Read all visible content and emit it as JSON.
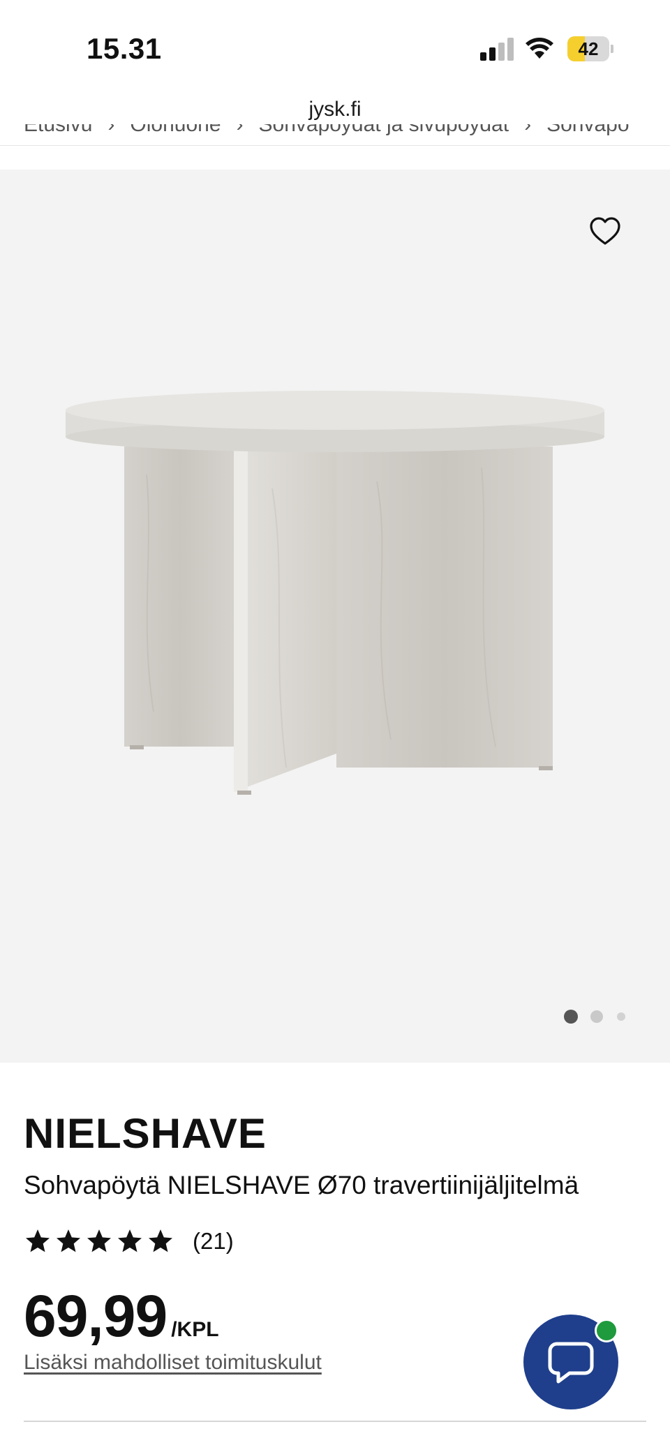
{
  "status_bar": {
    "time": "15.31",
    "battery_level": "42",
    "battery_fraction": 0.42,
    "signal_bars_active": 2,
    "icons": [
      "signal-icon",
      "wifi-icon",
      "battery-icon"
    ]
  },
  "browser": {
    "url": "jysk.fi"
  },
  "breadcrumb": {
    "items": [
      "Etusivu",
      "Olohuone",
      "Sohvapöydät ja sivupöydät",
      "Sohvapö"
    ]
  },
  "gallery": {
    "image_count": 3,
    "active_index": 0,
    "icons": [
      "heart-icon"
    ]
  },
  "product": {
    "brand": "NIELSHAVE",
    "name": "Sohvapöytä NIELSHAVE Ø70 travertiinijäljitelmä",
    "rating": 5,
    "review_count": "(21)",
    "price": "69,99",
    "unit": "/KPL",
    "shipping_note": "Lisäksi mahdolliset toimituskulut"
  },
  "chat": {
    "icon": "chat-bubble-icon",
    "online": true
  },
  "colors": {
    "chat_button": "#1f3f8c",
    "online_indicator": "#1f9a3d",
    "gallery_bg": "#f3f3f3",
    "battery_fill": "#f5cf2e"
  }
}
